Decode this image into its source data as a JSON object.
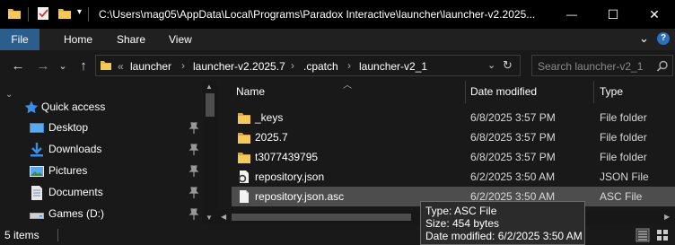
{
  "titlebar": {
    "path": "C:\\Users\\mag05\\AppData\\Local\\Programs\\Paradox Interactive\\launcher\\launcher-v2.2025...",
    "minimize_glyph": "—",
    "maximize_glyph": "☐",
    "close_glyph": "✕",
    "qat_dropdown_glyph": "▾"
  },
  "ribbon": {
    "tabs": [
      "File",
      "Home",
      "Share",
      "View"
    ],
    "collapse_glyph": "⌄",
    "help_glyph": "?"
  },
  "address": {
    "back_glyph": "←",
    "forward_glyph": "→",
    "recent_glyph": "⌄",
    "up_glyph": "↑",
    "overflow": "«",
    "crumbs": [
      "launcher",
      "launcher-v2.2025.7",
      ".cpatch",
      "launcher-v2_1"
    ],
    "dropdown_glyph": "⌄",
    "refresh_glyph": "↻",
    "search_placeholder": "Search launcher-v2_1"
  },
  "nav": {
    "quick_access": "Quick access",
    "items": [
      {
        "label": "Desktop",
        "icon": "desktop-icon"
      },
      {
        "label": "Downloads",
        "icon": "download-icon"
      },
      {
        "label": "Pictures",
        "icon": "pictures-icon"
      },
      {
        "label": "Documents",
        "icon": "documents-icon"
      },
      {
        "label": "Games (D:)",
        "icon": "drive-icon"
      }
    ]
  },
  "columns": {
    "name": "Name",
    "date": "Date modified",
    "type": "Type"
  },
  "files": [
    {
      "name": "_keys",
      "date": "6/8/2025 3:57 PM",
      "type": "File folder",
      "icon": "folder-icon"
    },
    {
      "name": "2025.7",
      "date": "6/8/2025 3:57 PM",
      "type": "File folder",
      "icon": "folder-icon"
    },
    {
      "name": "t3077439795",
      "date": "6/8/2025 3:57 PM",
      "type": "File folder",
      "icon": "folder-icon"
    },
    {
      "name": "repository.json",
      "date": "6/2/2025 3:50 AM",
      "type": "JSON File",
      "icon": "json-file-icon"
    },
    {
      "name": "repository.json.asc",
      "date": "6/2/2025 3:50 AM",
      "type": "ASC File",
      "icon": "file-icon"
    }
  ],
  "status": {
    "items_count": "5 items"
  },
  "tooltip": {
    "type": "Type: ASC File",
    "size": "Size: 454 bytes",
    "modified": "Date modified: 6/2/2025 3:50 AM"
  },
  "colors": {
    "folder": "#e8b84a",
    "file_tab": "#2b5e8c",
    "hover_row": "#4d4d4d",
    "accent": "#0078d7"
  }
}
